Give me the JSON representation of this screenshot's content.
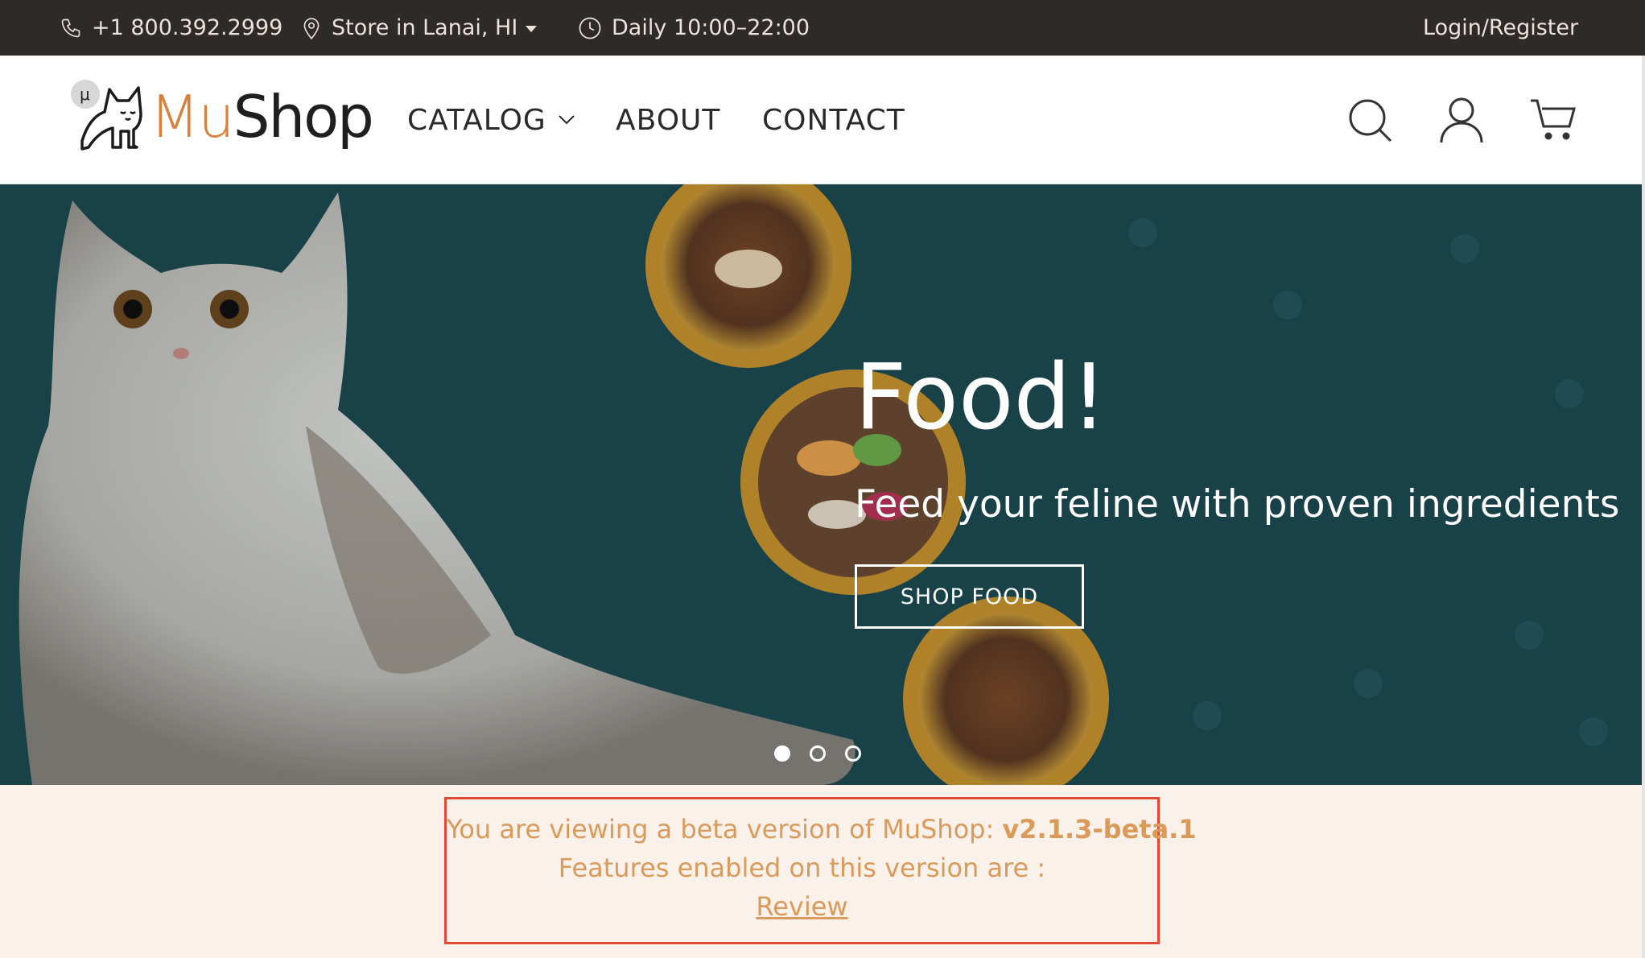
{
  "topbar": {
    "phone": "+1 800.392.2999",
    "store": "Store in Lanai, HI",
    "hours": "Daily 10:00–22:00",
    "login": "Login/Register"
  },
  "header": {
    "logo_mu": "Mu",
    "logo_shop": "Shop",
    "logo_badge": "μ",
    "nav": {
      "catalog": "CATALOG",
      "about": "ABOUT",
      "contact": "CONTACT"
    }
  },
  "hero": {
    "title": "Food!",
    "subtitle": "Feed your feline with proven ingredients",
    "button": "SHOP FOOD",
    "slides_total": 3,
    "active_slide": 1
  },
  "beta": {
    "line1_prefix": "You are viewing a beta version of MuShop: ",
    "version": "v2.1.3-beta.1",
    "line2": "Features enabled on this version are :",
    "link": "Review"
  },
  "colors": {
    "topbar_bg": "#2e2a27",
    "brand_orange": "#d9803b",
    "hero_bg": "#1d4b52",
    "beta_bg": "#faf1ea",
    "beta_text": "#d99a5a",
    "beta_border": "#e04a35"
  },
  "icons": {
    "phone": "phone-icon",
    "location": "location-pin-icon",
    "clock": "clock-icon",
    "search": "search-icon",
    "user": "user-icon",
    "cart": "cart-icon"
  }
}
